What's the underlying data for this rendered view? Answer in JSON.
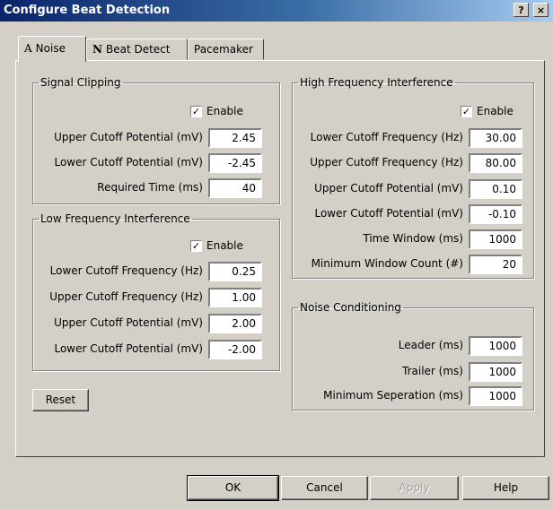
{
  "window": {
    "title": "Configure Beat Detection",
    "help_label": "?",
    "close_label": "×"
  },
  "tabs": [
    {
      "glyph": "A",
      "label": "Noise"
    },
    {
      "glyph": "N",
      "label": "Beat Detect"
    },
    {
      "label": "Pacemaker"
    }
  ],
  "signal_clipping": {
    "title": "Signal Clipping",
    "enable_label": "Enable",
    "enable_checked": true,
    "fields": [
      {
        "label": "Upper Cutoff Potential (mV)",
        "value": "2.45"
      },
      {
        "label": "Lower Cutoff Potential (mV)",
        "value": "-2.45"
      },
      {
        "label": "Required Time (ms)",
        "value": "40"
      }
    ]
  },
  "low_freq": {
    "title": "Low Frequency Interference",
    "enable_label": "Enable",
    "enable_checked": true,
    "fields": [
      {
        "label": "Lower Cutoff Frequency (Hz)",
        "value": "0.25"
      },
      {
        "label": "Upper Cutoff Frequency (Hz)",
        "value": "1.00"
      },
      {
        "label": "Upper Cutoff Potential (mV)",
        "value": "2.00"
      },
      {
        "label": "Lower Cutoff Potential (mV)",
        "value": "-2.00"
      }
    ]
  },
  "high_freq": {
    "title": "High Frequency Interference",
    "enable_label": "Enable",
    "enable_checked": true,
    "fields": [
      {
        "label": "Lower Cutoff Frequency (Hz)",
        "value": "30.00"
      },
      {
        "label": "Upper Cutoff Frequency (Hz)",
        "value": "80.00"
      },
      {
        "label": "Upper Cutoff Potential (mV)",
        "value": "0.10"
      },
      {
        "label": "Lower Cutoff Potential (mV)",
        "value": "-0.10"
      },
      {
        "label": "Time Window (ms)",
        "value": "1000"
      },
      {
        "label": "Minimum Window Count (#)",
        "value": "20"
      }
    ]
  },
  "noise_cond": {
    "title": "Noise Conditioning",
    "fields": [
      {
        "label": "Leader (ms)",
        "value": "1000"
      },
      {
        "label": "Trailer (ms)",
        "value": "1000"
      },
      {
        "label": "Minimum Seperation (ms)",
        "value": "1000"
      }
    ]
  },
  "buttons": {
    "reset": "Reset",
    "ok": "OK",
    "cancel": "Cancel",
    "apply": "Apply",
    "help": "Help"
  }
}
